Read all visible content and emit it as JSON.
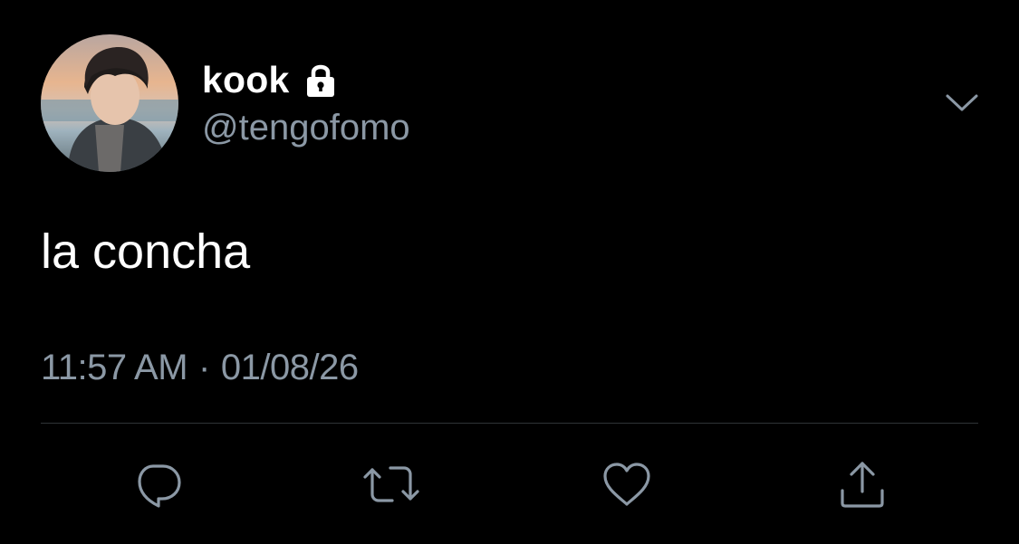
{
  "user": {
    "display_name": "kook",
    "handle": "@tengofomo",
    "protected": true,
    "avatar": "profile-photo"
  },
  "tweet": {
    "text": "la concha",
    "time": "11:57 AM",
    "separator": "·",
    "date": "01/08/26"
  },
  "actions": [
    {
      "name": "reply",
      "icon": "speech-bubble-icon"
    },
    {
      "name": "retweet",
      "icon": "retweet-arrows-icon"
    },
    {
      "name": "like",
      "icon": "heart-icon"
    },
    {
      "name": "share",
      "icon": "share-upload-icon"
    }
  ],
  "colors": {
    "background": "#000000",
    "primary_text": "#ffffff",
    "secondary_text": "#8b98a5",
    "divider": "#2f3336"
  }
}
